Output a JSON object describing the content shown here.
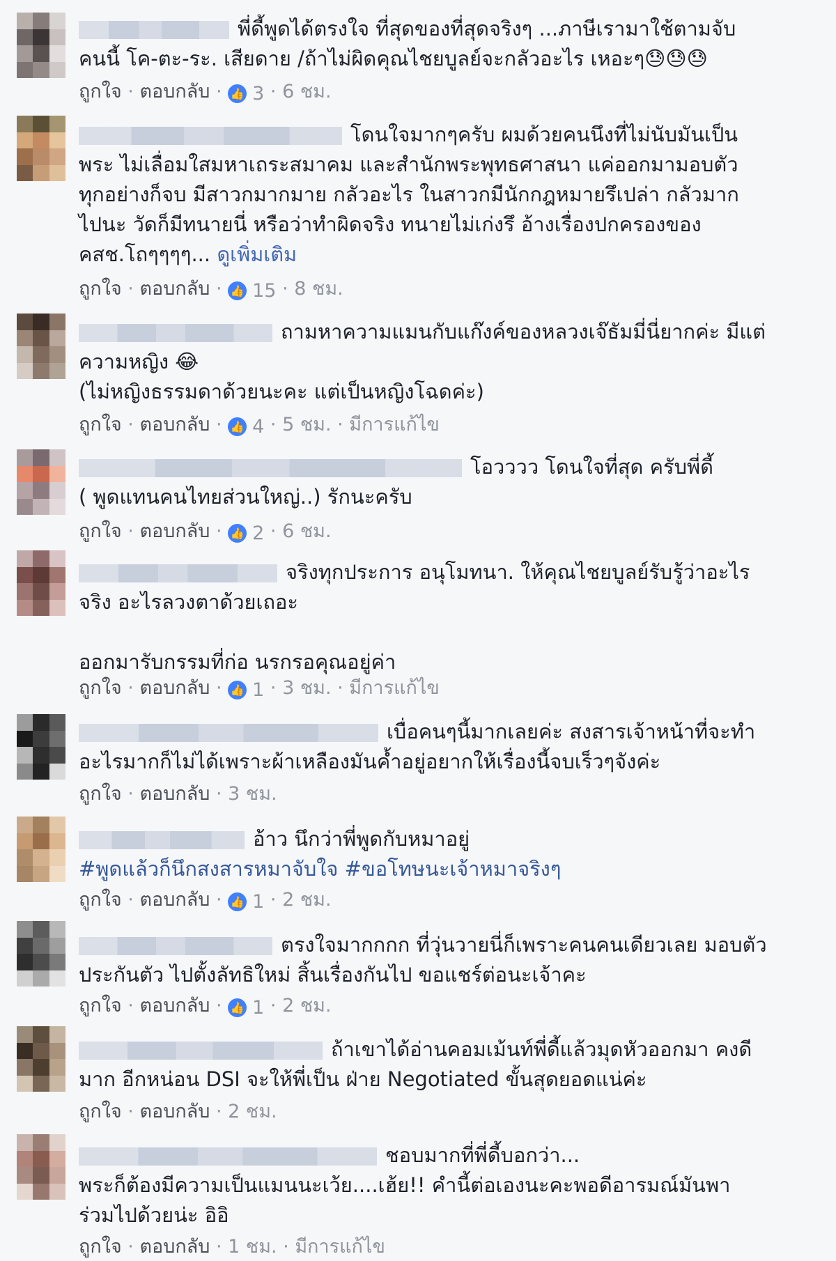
{
  "labels": {
    "like": "ถูกใจ",
    "reply": "ตอบกลับ",
    "sep": " · "
  },
  "comments": [
    {
      "text": "พี่ดี้พูดได้ตรงใจ ที่สุดของที่สุดจริงๆ ...ภาษีเรามาใช้ตามจับ\nคนนี้ โค-ตะ-ระ. เสียดาย /ถ้าไม่ผิดคุณไชยบูลย์จะกลัวอะไร เหอะๆ😓😓😓",
      "likes": "3",
      "time": "6 ชม.",
      "edited": "",
      "more": ""
    },
    {
      "text": "โดนใจมากๆครับ ผมด้วยคนนึงที่ไม่นับมันเป็น\nพระ ไม่เลื่อมใสมหาเถระสมาคม และสำนักพระพุทธศาสนา แค่ออกมามอบตัว\nทุกอย่างก็จบ มีสาวกมากมาย กลัวอะไร ในสาวกมีนักกฎหมายรึเปล่า กลัวมาก\nไปนะ วัดก็มีทนายนี่ หรือว่าทำผิดจริง ทนายไม่เก่งรึ อ้างเรื่องปกครองของ\nคสช.โถๆๆๆๆ...",
      "more": "ดูเพิ่มเติม",
      "likes": "15",
      "time": "8 ชม.",
      "edited": ""
    },
    {
      "text": "ถามหาความแมนกับแก๊งค์ของหลวงเจ๊ธัมมี่นี่ยากค่ะ มีแต่\nความหญิง 😂\n(ไม่หญิงธรรมดาด้วยนะคะ แต่เป็นหญิงโฉดค่ะ)",
      "likes": "4",
      "time": "5 ชม.",
      "edited": "มีการแก้ไข",
      "more": ""
    },
    {
      "text": "โอวววว โดนใจที่สุด ครับพี่ดี้\n( พูดแทนคนไทยส่วนใหญ่..) รักนะครับ",
      "likes": "2",
      "time": "6 ชม.",
      "edited": "",
      "more": ""
    },
    {
      "text": "จริงทุกประการ อนุโมทนา. ให้คุณไชยบูลย์รับรู้ว่าอะไร\nจริง อะไรลวงตาด้วยเถอะ\n\nออกมารับกรรมที่ก่อ นรกรอคุณอยู่ค่า",
      "likes": "1",
      "time": "3 ชม.",
      "edited": "มีการแก้ไข",
      "more": ""
    },
    {
      "text": "เบื่อคนๆนี้มากเลยค่ะ สงสารเจ้าหน้าที่จะทำ\nอะไรมากก็ไม่ได้เพราะผ้าเหลืองมันค้ำอยู่อยากให้เรื่องนี้จบเร็วๆจังค่ะ",
      "likes": "",
      "time": "3 ชม.",
      "edited": "",
      "more": ""
    },
    {
      "text": "อ้าว นึกว่าพี่พูดกับหมาอยู่",
      "tags": "#พูดแล้วก็นึกสงสารหมาจับใจ #ขอโทษนะเจ้าหมาจริงๆ",
      "likes": "1",
      "time": "2 ชม.",
      "edited": "",
      "more": ""
    },
    {
      "text": "ตรงใจมากกกก ที่วุ่นวายนี่ก็เพราะคนคนเดียวเลย มอบตัว\nประกันตัว ไปตั้งลัทธิใหม่ สิ้นเรื่องกันไป ขอแชร์ต่อนะเจ้าคะ",
      "likes": "1",
      "time": "2 ชม.",
      "edited": "",
      "more": ""
    },
    {
      "text": "ถ้าเขาได้อ่านคอมเม้นท์พี่ดี้แล้วมุดหัวออกมา คงดี\nมาก อีกหน่อน DSI จะให้พี่เป็น ฝ่าย Negotiated ขั้นสุดยอดแน่ค่ะ",
      "likes": "",
      "time": "2 ชม.",
      "edited": "",
      "more": ""
    },
    {
      "text": "ชอบมากที่พี่ดี้บอกว่า...\nพระก็ต้องมีความเป็นแมนนะเว้ย....เฮ้ย!! คำนี้ต่อเองนะคะพอดีอารมณ์มันพา\nร่วมไปด้วยน่ะ อิอิ",
      "likes": "",
      "time": "1 ชม.",
      "edited": "มีการแก้ไข",
      "more": ""
    }
  ],
  "colors": {
    "link": "#4b4f56",
    "meta": "#90949c",
    "like_badge": "#4080ff",
    "see_more": "#4267b2",
    "hashtag": "#365899"
  }
}
